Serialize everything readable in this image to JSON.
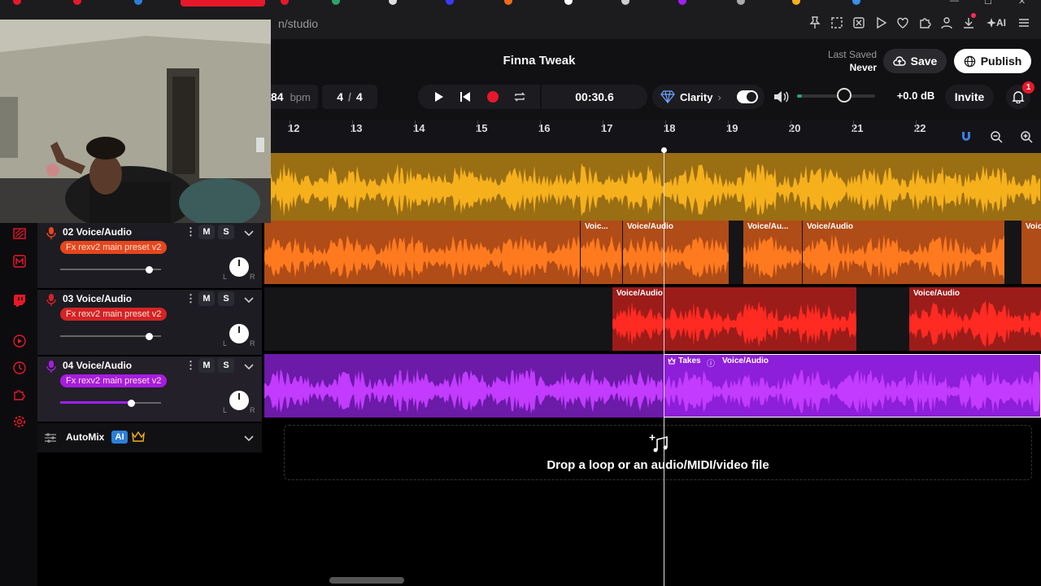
{
  "browser": {
    "tabs": [],
    "url": "n/studio",
    "ext_icons": [
      "pin-icon",
      "screenshot-icon",
      "close-box-icon",
      "play-icon",
      "heart-icon",
      "puzzle-icon",
      "profile-icon",
      "download-icon"
    ],
    "ai_label": "AI"
  },
  "header": {
    "project_title": "Finna Tweak",
    "last_saved_label": "Last Saved",
    "last_saved_value": "Never",
    "save_label": "Save",
    "publish_label": "Publish"
  },
  "toolbar": {
    "bpm_value": "84",
    "bpm_unit": "bpm",
    "time_sig_top": "4",
    "time_sig_sep": "/",
    "time_sig_bottom": "4",
    "time": "00:30.6",
    "clarity_label": "Clarity",
    "clarity_chevron": "›",
    "clarity_on": true,
    "master_volume": 0.6,
    "db": "+0.0 dB",
    "invite_label": "Invite",
    "notification_count": "1"
  },
  "ruler": {
    "numbers": [
      "12",
      "13",
      "14",
      "15",
      "16",
      "17",
      "18",
      "19",
      "20",
      "21",
      "22"
    ]
  },
  "tracks": [
    {
      "number": "02",
      "name": "02 Voice/Audio",
      "fx": "Fx rexv2 main preset v2",
      "color": "#f26a1b",
      "fx_bg": "#e5461e",
      "volume": 0.98,
      "m": "M",
      "s": "S",
      "menu": "⋮",
      "pan_l": "L",
      "pan_r": "R"
    },
    {
      "number": "03",
      "name": "03 Voice/Audio",
      "fx": "Fx rexv2 main preset v2",
      "color": "#e42a24",
      "fx_bg": "#d42326",
      "volume": 0.98,
      "m": "M",
      "s": "S",
      "menu": "⋮",
      "pan_l": "L",
      "pan_r": "R"
    },
    {
      "number": "04",
      "name": "04 Voice/Audio",
      "fx": "Fx rexv2 main preset v2",
      "color": "#a020f0",
      "fx_bg": "#a71ce0",
      "volume": 0.78,
      "m": "M",
      "s": "S",
      "menu": "⋮",
      "pan_l": "L",
      "pan_r": "R"
    }
  ],
  "clips": {
    "track2": [
      "Voic...",
      "Voice/Audio",
      "Voice/Au...",
      "Voice/Audio",
      "Voic"
    ],
    "track3": [
      "Voice/Audio",
      "Voice/Audio"
    ],
    "track4_takes": "Takes",
    "track4_takes_info": "ⓘ",
    "track4_clip": "Voice/Audio"
  },
  "automix": {
    "label": "AutoMix",
    "ai_badge": "AI"
  },
  "dropzone": {
    "text": "Drop a loop or an audio/MIDI/video file"
  },
  "colors": {
    "yellow": "#f5b01c",
    "orange": "#f26a1b",
    "red": "#e42a24",
    "purple": "#a020f0",
    "accent_red": "#e8182b"
  }
}
